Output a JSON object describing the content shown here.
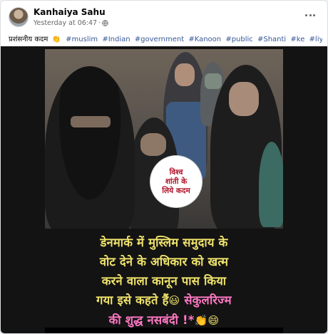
{
  "post": {
    "author": "Kanhaiya Sahu",
    "timestamp": "Yesterday at 06:47",
    "separator": "·",
    "caption_text": "प्रशंसनीय कदम",
    "caption_emoji": "👏",
    "hashtags": [
      "#muslim",
      "#Indian",
      "#government",
      "#Kanoon",
      "#public",
      "#Shanti",
      "#ke",
      "#liye"
    ]
  },
  "image": {
    "badge_lines": [
      "विश्व",
      "शांती के",
      "लिये कदम"
    ],
    "headline_lines": [
      "डेनमार्क में मुस्लिम समुदाय के",
      "वोट देने के अधिकार को खत्म",
      "करने वाला कानून पास किया"
    ],
    "headline_line4_yellow": "गया इसे कहते हैं",
    "headline_line4_emoji": "😃",
    "headline_line4_pink": "सेकुलरिज्म",
    "headline_line5_pink": "की शुद्ध नसबंदी !*",
    "headline_line5_emoji1": "👏",
    "headline_line5_emoji2": "😄"
  },
  "colors": {
    "headline_yellow": "#f0e36b",
    "headline_pink": "#ff78c4",
    "badge_red": "#b0142a",
    "link_blue": "#385898"
  }
}
